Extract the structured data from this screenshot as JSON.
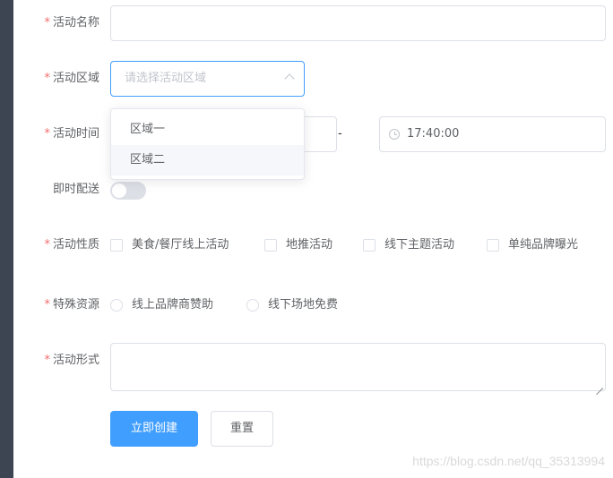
{
  "form": {
    "name": {
      "label": "活动名称",
      "value": ""
    },
    "region": {
      "label": "活动区域",
      "placeholder": "请选择活动区域",
      "options": [
        "区域一",
        "区域二"
      ],
      "hovered_option": "区域二"
    },
    "time": {
      "label": "活动时间",
      "separator": "-",
      "time_value": "17:40:00"
    },
    "delivery": {
      "label": "即时配送",
      "on": false
    },
    "type": {
      "label": "活动性质",
      "options": [
        "美食/餐厅线上活动",
        "地推活动",
        "线下主题活动",
        "单纯品牌曝光"
      ]
    },
    "resource": {
      "label": "特殊资源",
      "options": [
        "线上品牌商赞助",
        "线下场地免费"
      ]
    },
    "desc": {
      "label": "活动形式",
      "value": ""
    },
    "buttons": {
      "submit": "立即创建",
      "reset": "重置"
    }
  },
  "watermark": "https://blog.csdn.net/qq_35313994",
  "colors": {
    "primary": "#409eff",
    "required": "#f56c6c",
    "border": "#dcdfe6",
    "text": "#606266",
    "placeholder": "#c0c4cc"
  }
}
